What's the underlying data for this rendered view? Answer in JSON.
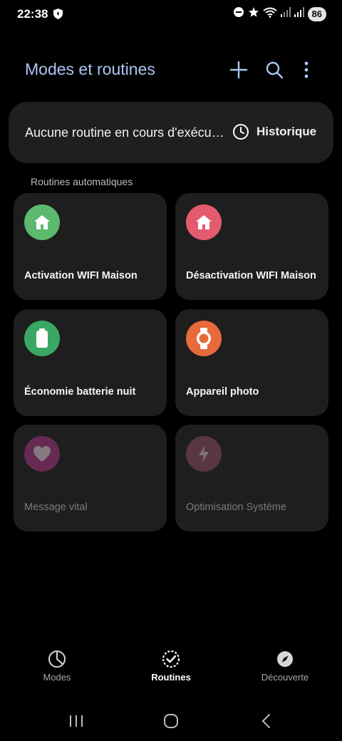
{
  "status_bar": {
    "time": "22:38",
    "battery": "86",
    "icons": [
      "shield-icon",
      "do-not-disturb-icon",
      "star-icon",
      "wifi-icon",
      "signal-icon",
      "signal-icon"
    ]
  },
  "header": {
    "title": "Modes et routines",
    "actions": [
      "add-icon",
      "search-icon",
      "more-vert-icon"
    ]
  },
  "running_card": {
    "text": "Aucune routine en cours d'exécution",
    "history_label": "Historique"
  },
  "section": {
    "title": "Routines automatiques"
  },
  "routines": [
    {
      "label": "Activation WIFI Maison",
      "icon": "home-icon",
      "color": "#5cb96e",
      "enabled": true
    },
    {
      "label": "Désactivation WIFI Maison",
      "icon": "home-icon",
      "color": "#e45a6e",
      "enabled": true
    },
    {
      "label": "Économie batterie nuit",
      "icon": "battery-icon",
      "color": "#3aa864",
      "enabled": true
    },
    {
      "label": "Appareil photo",
      "icon": "watch-icon",
      "color": "#e8693a",
      "enabled": true
    },
    {
      "label": "Message vital",
      "icon": "heart-icon",
      "color": "#a2347f",
      "enabled": false
    },
    {
      "label": "Optimisation Système",
      "icon": "bolt-icon",
      "color": "#8c4a5e",
      "enabled": false
    }
  ],
  "bottom_nav": [
    {
      "label": "Modes",
      "icon": "pie-icon",
      "active": false
    },
    {
      "label": "Routines",
      "icon": "routine-check-icon",
      "active": true
    },
    {
      "label": "Découverte",
      "icon": "compass-icon",
      "active": false
    }
  ],
  "system_nav": [
    "recents-icon",
    "home-circle-icon",
    "back-icon"
  ],
  "colors": {
    "background": "#000000",
    "card": "#1f1f1f",
    "title": "#a9c6f3"
  }
}
